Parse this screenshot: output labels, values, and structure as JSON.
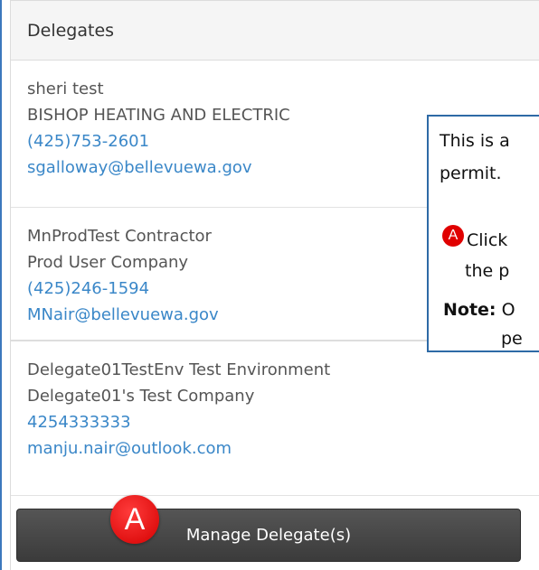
{
  "panel": {
    "title": "Delegates"
  },
  "delegates": [
    {
      "name": "sheri test",
      "company": "BISHOP HEATING AND ELECTRIC",
      "phone": "(425)753-2601",
      "email": "sgalloway@bellevuewa.gov"
    },
    {
      "name": "MnProdTest Contractor",
      "company": "Prod User Company",
      "phone": "(425)246-1594",
      "email": "MNair@bellevuewa.gov"
    },
    {
      "name": "Delegate01TestEnv Test Environment",
      "company": "Delegate01's Test Company",
      "phone": "4254333333",
      "email": "manju.nair@outlook.com"
    }
  ],
  "manage_button": {
    "label": "Manage Delegate(s)",
    "badge": "A"
  },
  "callout": {
    "line1": "This is a",
    "line2": "permit.",
    "badge": "A",
    "line3": "Click",
    "line4": "the p",
    "note_label": "Note:",
    "note_text": "O",
    "line6": "pe"
  },
  "colors": {
    "link": "#3a87c8",
    "badge": "#e00000",
    "frame": "#3c78bd"
  }
}
